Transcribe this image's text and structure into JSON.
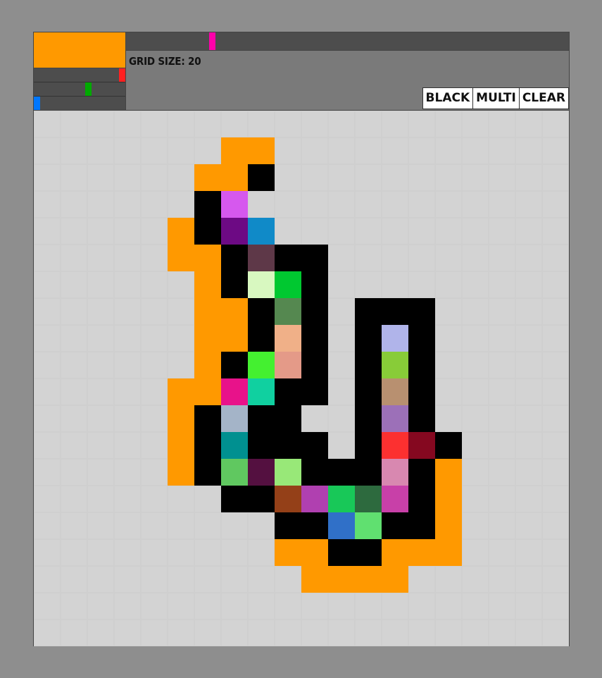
{
  "header": {
    "grid_size_label": "GRID SIZE: 20",
    "preview_color": "#ff9900",
    "hue_slider": {
      "value": 0.19,
      "color": "#ff00aa"
    },
    "red_slider": {
      "value": 1.0,
      "color": "#ff2020"
    },
    "green_slider": {
      "value": 0.6,
      "color": "#00aa00"
    },
    "blue_slider": {
      "value": 0.0,
      "color": "#0077ff"
    }
  },
  "toolbar": {
    "black_label": "BLACK",
    "multi_label": "MULTI",
    "clear_label": "CLEAR"
  },
  "grid": {
    "size": 20,
    "background": "#d3d3d3",
    "cells": [
      {
        "r": 1,
        "c": 7,
        "color": "#ff9900"
      },
      {
        "r": 1,
        "c": 8,
        "color": "#ff9900"
      },
      {
        "r": 2,
        "c": 6,
        "color": "#ff9900"
      },
      {
        "r": 2,
        "c": 7,
        "color": "#ff9900"
      },
      {
        "r": 2,
        "c": 8,
        "color": "#000000"
      },
      {
        "r": 3,
        "c": 6,
        "color": "#000000"
      },
      {
        "r": 3,
        "c": 7,
        "color": "#d658ee"
      },
      {
        "r": 4,
        "c": 5,
        "color": "#ff9900"
      },
      {
        "r": 4,
        "c": 6,
        "color": "#000000"
      },
      {
        "r": 4,
        "c": 7,
        "color": "#6d0a84"
      },
      {
        "r": 4,
        "c": 8,
        "color": "#108ac8"
      },
      {
        "r": 5,
        "c": 5,
        "color": "#ff9900"
      },
      {
        "r": 5,
        "c": 6,
        "color": "#ff9900"
      },
      {
        "r": 5,
        "c": 7,
        "color": "#000000"
      },
      {
        "r": 5,
        "c": 8,
        "color": "#5e3848"
      },
      {
        "r": 5,
        "c": 9,
        "color": "#000000"
      },
      {
        "r": 5,
        "c": 10,
        "color": "#000000"
      },
      {
        "r": 6,
        "c": 6,
        "color": "#ff9900"
      },
      {
        "r": 6,
        "c": 7,
        "color": "#000000"
      },
      {
        "r": 6,
        "c": 8,
        "color": "#d8f8c0"
      },
      {
        "r": 6,
        "c": 9,
        "color": "#00c830"
      },
      {
        "r": 6,
        "c": 10,
        "color": "#000000"
      },
      {
        "r": 7,
        "c": 6,
        "color": "#ff9900"
      },
      {
        "r": 7,
        "c": 7,
        "color": "#ff9900"
      },
      {
        "r": 7,
        "c": 8,
        "color": "#000000"
      },
      {
        "r": 7,
        "c": 9,
        "color": "#558850"
      },
      {
        "r": 7,
        "c": 10,
        "color": "#000000"
      },
      {
        "r": 7,
        "c": 12,
        "color": "#000000"
      },
      {
        "r": 7,
        "c": 13,
        "color": "#000000"
      },
      {
        "r": 7,
        "c": 14,
        "color": "#000000"
      },
      {
        "r": 8,
        "c": 6,
        "color": "#ff9900"
      },
      {
        "r": 8,
        "c": 7,
        "color": "#ff9900"
      },
      {
        "r": 8,
        "c": 8,
        "color": "#000000"
      },
      {
        "r": 8,
        "c": 9,
        "color": "#f0b088"
      },
      {
        "r": 8,
        "c": 10,
        "color": "#000000"
      },
      {
        "r": 8,
        "c": 12,
        "color": "#000000"
      },
      {
        "r": 8,
        "c": 13,
        "color": "#b0b4ea"
      },
      {
        "r": 8,
        "c": 14,
        "color": "#000000"
      },
      {
        "r": 9,
        "c": 6,
        "color": "#ff9900"
      },
      {
        "r": 9,
        "c": 7,
        "color": "#000000"
      },
      {
        "r": 9,
        "c": 8,
        "color": "#44f030"
      },
      {
        "r": 9,
        "c": 9,
        "color": "#e49a88"
      },
      {
        "r": 9,
        "c": 10,
        "color": "#000000"
      },
      {
        "r": 9,
        "c": 12,
        "color": "#000000"
      },
      {
        "r": 9,
        "c": 13,
        "color": "#88cc38"
      },
      {
        "r": 9,
        "c": 14,
        "color": "#000000"
      },
      {
        "r": 10,
        "c": 5,
        "color": "#ff9900"
      },
      {
        "r": 10,
        "c": 6,
        "color": "#ff9900"
      },
      {
        "r": 10,
        "c": 7,
        "color": "#e8128a"
      },
      {
        "r": 10,
        "c": 8,
        "color": "#10d0a0"
      },
      {
        "r": 10,
        "c": 9,
        "color": "#000000"
      },
      {
        "r": 10,
        "c": 10,
        "color": "#000000"
      },
      {
        "r": 10,
        "c": 12,
        "color": "#000000"
      },
      {
        "r": 10,
        "c": 13,
        "color": "#b89070"
      },
      {
        "r": 10,
        "c": 14,
        "color": "#000000"
      },
      {
        "r": 11,
        "c": 5,
        "color": "#ff9900"
      },
      {
        "r": 11,
        "c": 6,
        "color": "#000000"
      },
      {
        "r": 11,
        "c": 7,
        "color": "#a4b4c8"
      },
      {
        "r": 11,
        "c": 8,
        "color": "#000000"
      },
      {
        "r": 11,
        "c": 9,
        "color": "#000000"
      },
      {
        "r": 11,
        "c": 12,
        "color": "#000000"
      },
      {
        "r": 11,
        "c": 13,
        "color": "#9c70b8"
      },
      {
        "r": 11,
        "c": 14,
        "color": "#000000"
      },
      {
        "r": 12,
        "c": 5,
        "color": "#ff9900"
      },
      {
        "r": 12,
        "c": 6,
        "color": "#000000"
      },
      {
        "r": 12,
        "c": 7,
        "color": "#009090"
      },
      {
        "r": 12,
        "c": 8,
        "color": "#000000"
      },
      {
        "r": 12,
        "c": 9,
        "color": "#000000"
      },
      {
        "r": 12,
        "c": 10,
        "color": "#000000"
      },
      {
        "r": 12,
        "c": 12,
        "color": "#000000"
      },
      {
        "r": 12,
        "c": 13,
        "color": "#fc3030"
      },
      {
        "r": 12,
        "c": 14,
        "color": "#850820"
      },
      {
        "r": 12,
        "c": 15,
        "color": "#000000"
      },
      {
        "r": 13,
        "c": 5,
        "color": "#ff9900"
      },
      {
        "r": 13,
        "c": 6,
        "color": "#000000"
      },
      {
        "r": 13,
        "c": 7,
        "color": "#60c860"
      },
      {
        "r": 13,
        "c": 8,
        "color": "#541040"
      },
      {
        "r": 13,
        "c": 9,
        "color": "#98e878"
      },
      {
        "r": 13,
        "c": 10,
        "color": "#000000"
      },
      {
        "r": 13,
        "c": 11,
        "color": "#000000"
      },
      {
        "r": 13,
        "c": 12,
        "color": "#000000"
      },
      {
        "r": 13,
        "c": 13,
        "color": "#d888b0"
      },
      {
        "r": 13,
        "c": 14,
        "color": "#000000"
      },
      {
        "r": 13,
        "c": 15,
        "color": "#ff9900"
      },
      {
        "r": 14,
        "c": 7,
        "color": "#000000"
      },
      {
        "r": 14,
        "c": 8,
        "color": "#000000"
      },
      {
        "r": 14,
        "c": 9,
        "color": "#944018"
      },
      {
        "r": 14,
        "c": 10,
        "color": "#b040b0"
      },
      {
        "r": 14,
        "c": 11,
        "color": "#18c858"
      },
      {
        "r": 14,
        "c": 12,
        "color": "#2d6a3e"
      },
      {
        "r": 14,
        "c": 13,
        "color": "#c840a8"
      },
      {
        "r": 14,
        "c": 14,
        "color": "#000000"
      },
      {
        "r": 14,
        "c": 15,
        "color": "#ff9900"
      },
      {
        "r": 15,
        "c": 9,
        "color": "#000000"
      },
      {
        "r": 15,
        "c": 10,
        "color": "#000000"
      },
      {
        "r": 15,
        "c": 11,
        "color": "#3070c8"
      },
      {
        "r": 15,
        "c": 12,
        "color": "#60e070"
      },
      {
        "r": 15,
        "c": 13,
        "color": "#000000"
      },
      {
        "r": 15,
        "c": 14,
        "color": "#000000"
      },
      {
        "r": 15,
        "c": 15,
        "color": "#ff9900"
      },
      {
        "r": 16,
        "c": 9,
        "color": "#ff9900"
      },
      {
        "r": 16,
        "c": 10,
        "color": "#ff9900"
      },
      {
        "r": 16,
        "c": 11,
        "color": "#000000"
      },
      {
        "r": 16,
        "c": 12,
        "color": "#000000"
      },
      {
        "r": 16,
        "c": 13,
        "color": "#ff9900"
      },
      {
        "r": 16,
        "c": 14,
        "color": "#ff9900"
      },
      {
        "r": 16,
        "c": 15,
        "color": "#ff9900"
      },
      {
        "r": 17,
        "c": 10,
        "color": "#ff9900"
      },
      {
        "r": 17,
        "c": 11,
        "color": "#ff9900"
      },
      {
        "r": 17,
        "c": 12,
        "color": "#ff9900"
      },
      {
        "r": 17,
        "c": 13,
        "color": "#ff9900"
      }
    ]
  }
}
